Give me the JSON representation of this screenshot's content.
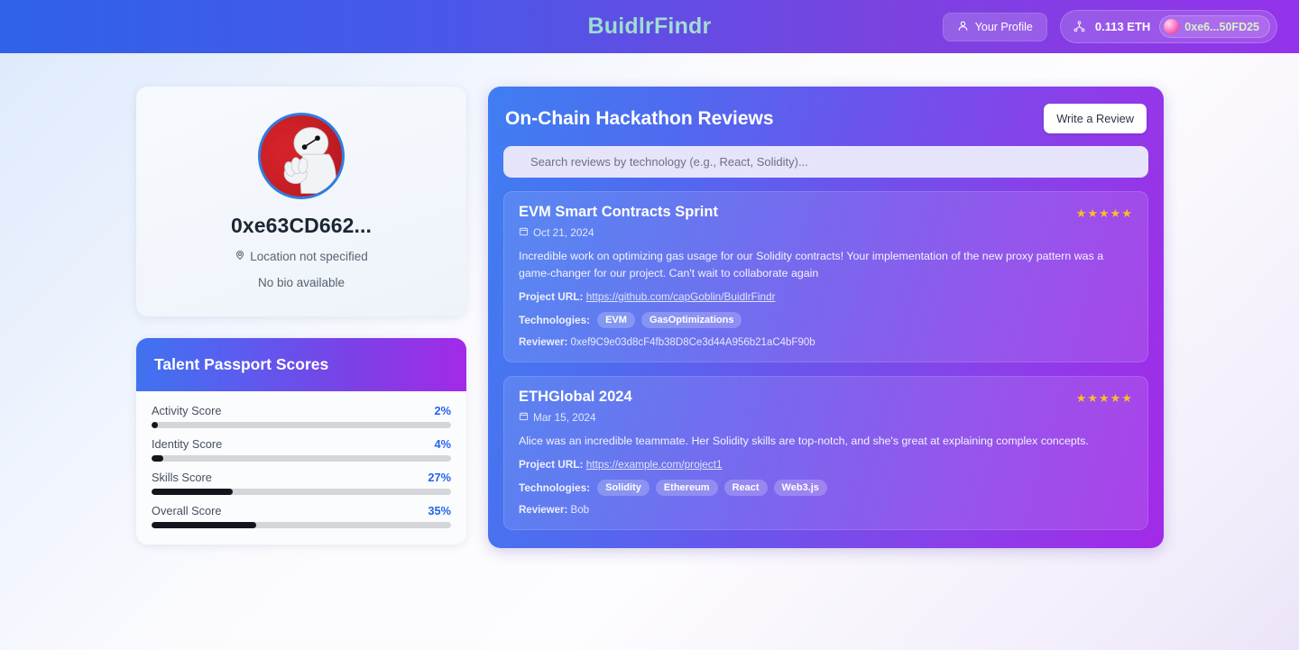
{
  "header": {
    "brand": "BuidlrFindr",
    "profile_button": "Your Profile",
    "balance": "0.113 ETH",
    "address_short": "0xe6...50FD25",
    "profile_icon": "person-icon",
    "network_icon": "network-nodes-icon",
    "address_avatar_icon": "wallet-avatar-icon"
  },
  "profile": {
    "avatar_icon": "baymax-avatar",
    "name": "0xe63CD662...",
    "location": "Location not specified",
    "location_icon": "map-pin-icon",
    "bio": "No bio available"
  },
  "scores": {
    "title": "Talent Passport Scores",
    "items": [
      {
        "label": "Activity Score",
        "value": "2%",
        "pct": 2
      },
      {
        "label": "Identity Score",
        "value": "4%",
        "pct": 4
      },
      {
        "label": "Skills Score",
        "value": "27%",
        "pct": 27
      },
      {
        "label": "Overall Score",
        "value": "35%",
        "pct": 35
      }
    ]
  },
  "reviews_panel": {
    "title": "On-Chain Hackathon Reviews",
    "write_button": "Write a Review",
    "search_placeholder": "Search reviews by technology (e.g., React, Solidity)...",
    "search_value": "",
    "labels": {
      "project_url": "Project URL:",
      "technologies": "Technologies:",
      "reviewer": "Reviewer:",
      "date_icon": "calendar-icon"
    },
    "reviews": [
      {
        "title": "EVM Smart Contracts Sprint",
        "date": "Oct 21, 2024",
        "rating": 5,
        "stars": "★★★★★",
        "comment": "Incredible work on optimizing gas usage for our Solidity contracts! Your implementation of the new proxy pattern was a game-changer for our project. Can't wait to collaborate again",
        "project_url": "https://github.com/capGoblin/BuidlrFindr",
        "technologies": [
          "EVM",
          "GasOptimizations"
        ],
        "reviewer": "0xef9C9e03d8cF4fb38D8Ce3d44A956b21aC4bF90b"
      },
      {
        "title": "ETHGlobal 2024",
        "date": "Mar 15, 2024",
        "rating": 5,
        "stars": "★★★★★",
        "comment": "Alice was an incredible teammate. Her Solidity skills are top-notch, and she's great at explaining complex concepts.",
        "project_url": "https://example.com/project1",
        "technologies": [
          "Solidity",
          "Ethereum",
          "React",
          "Web3.js"
        ],
        "reviewer": "Bob"
      }
    ]
  },
  "colors": {
    "brand_gradient_start": "#6ee7a0",
    "brand_gradient_end": "#c9d6f7",
    "panel_gradient_start": "#3f7ef2",
    "panel_gradient_end": "#a22ae8",
    "score_value": "#2563eb",
    "bar_fill": "#12161c",
    "star": "#fbbf24"
  }
}
